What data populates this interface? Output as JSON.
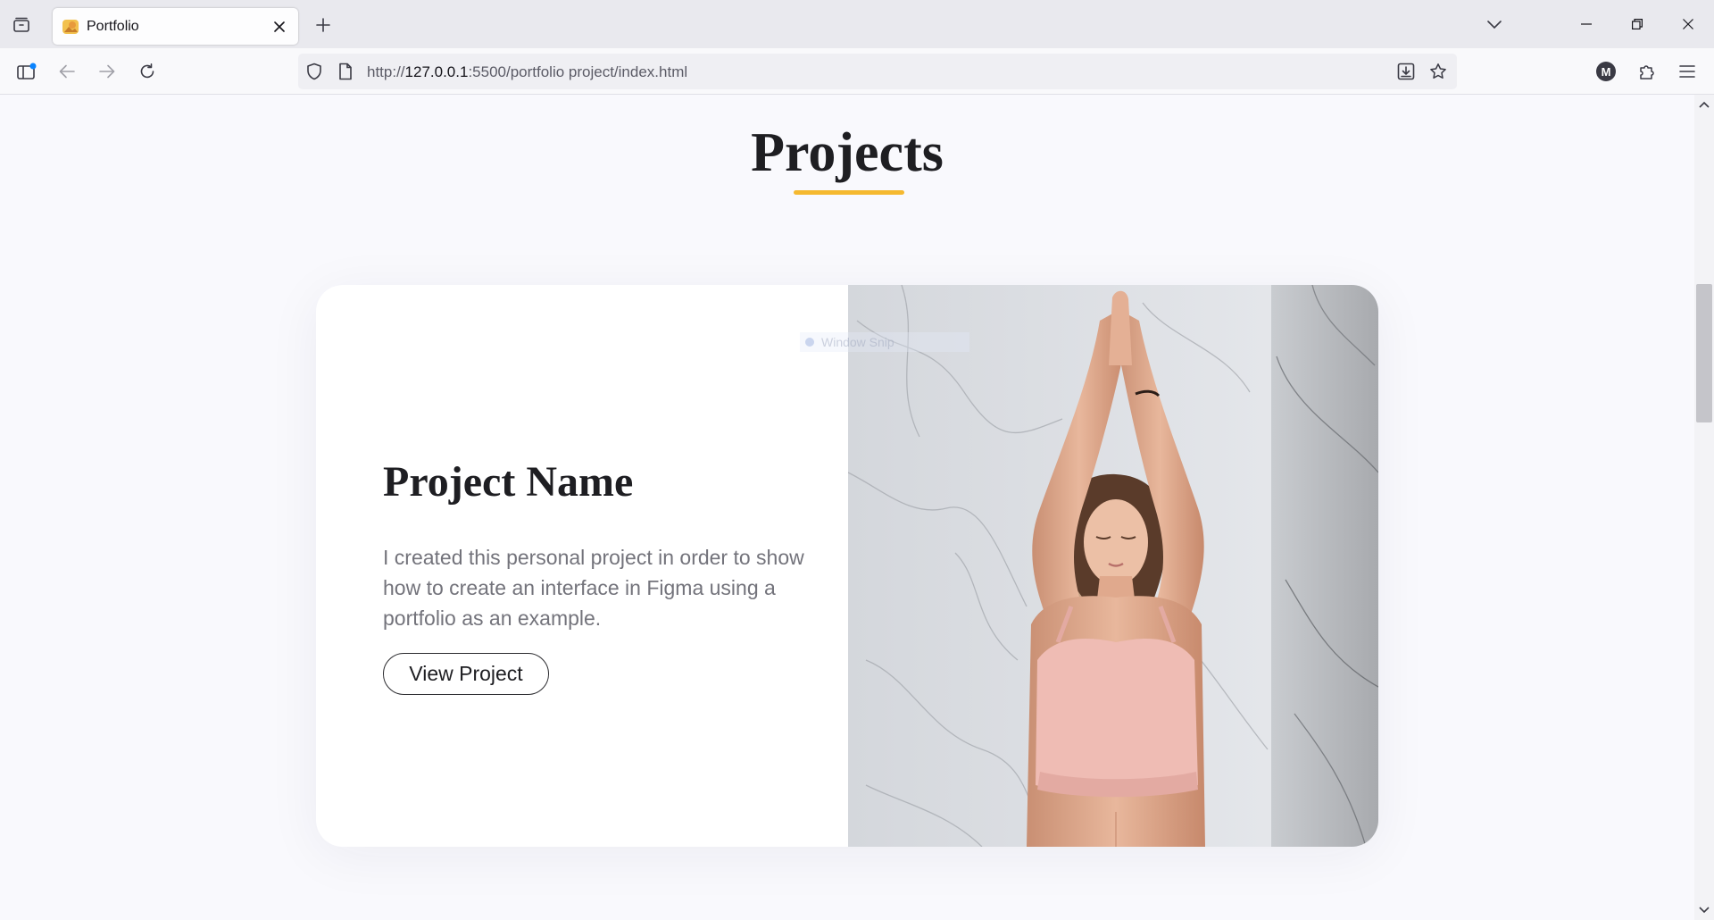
{
  "browser": {
    "tab": {
      "title": "Portfolio"
    },
    "url": {
      "prefix": "http://",
      "host": "127.0.0.1",
      "rest": ":5500/portfolio project/index.html"
    },
    "account_initial": "M"
  },
  "page": {
    "section_title": "Projects",
    "accent_color": "#f5b930",
    "project": {
      "name": "Project Name",
      "description": "I created this personal project in order to show how to create an interface in Figma using a portfolio as an example.",
      "button_label": "View Project",
      "image_alt": "Woman in pink sports top doing a yoga pose with arms raised in front of a marble wall"
    }
  },
  "overlay": {
    "label": "Window Snip"
  }
}
